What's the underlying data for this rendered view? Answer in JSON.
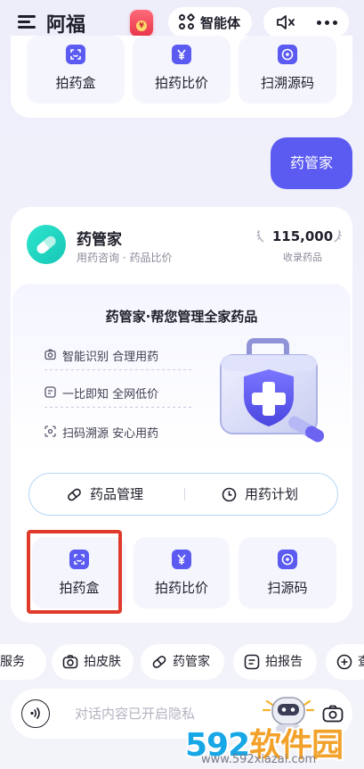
{
  "header": {
    "app_title": "阿福",
    "redpacket_glyph": "¥",
    "agent_label": "智能体"
  },
  "top_tools": [
    {
      "label": "拍药盒",
      "icon": "scan-box-icon"
    },
    {
      "label": "拍药比价",
      "icon": "yen-icon"
    },
    {
      "label": "扫溯源码",
      "icon": "target-code-icon"
    }
  ],
  "user_message": "药管家",
  "card": {
    "title": "药管家",
    "subtitle": "用药咨询 · 药品比价",
    "stat_value": "115,000",
    "stat_label": "收录药品",
    "panel_title": "药管家·帮您管理全家药品",
    "features": [
      {
        "label": "智能识别 合理用药",
        "icon": "camera-small-icon"
      },
      {
        "label": "一比即知 全网低价",
        "icon": "list-small-icon"
      },
      {
        "label": "扫码溯源 安心用药",
        "icon": "scan-small-icon"
      }
    ],
    "segments": [
      {
        "label": "药品管理",
        "icon": "capsule-icon"
      },
      {
        "label": "用药计划",
        "icon": "clock-icon"
      }
    ],
    "tools": [
      {
        "label": "拍药盒",
        "icon": "scan-box-icon",
        "selected": true
      },
      {
        "label": "拍药比价",
        "icon": "yen-icon"
      },
      {
        "label": "扫源码",
        "icon": "target-code-icon"
      }
    ]
  },
  "chips": [
    {
      "label": "服务",
      "icon": ""
    },
    {
      "label": "拍皮肤",
      "icon": "camera-icon"
    },
    {
      "label": "药管家",
      "icon": "capsule-icon"
    },
    {
      "label": "拍报告",
      "icon": "report-icon"
    },
    {
      "label": "查",
      "icon": "plus-icon"
    }
  ],
  "input": {
    "placeholder": "对话内容已开启隐私"
  },
  "watermark": {
    "brand_num": "592",
    "brand_text": "软件园",
    "url": "www.592xiazai.com"
  },
  "colors": {
    "accent": "#5b5bf2",
    "teal": "#1ecfbd",
    "highlight_frame": "#e03a2b"
  }
}
